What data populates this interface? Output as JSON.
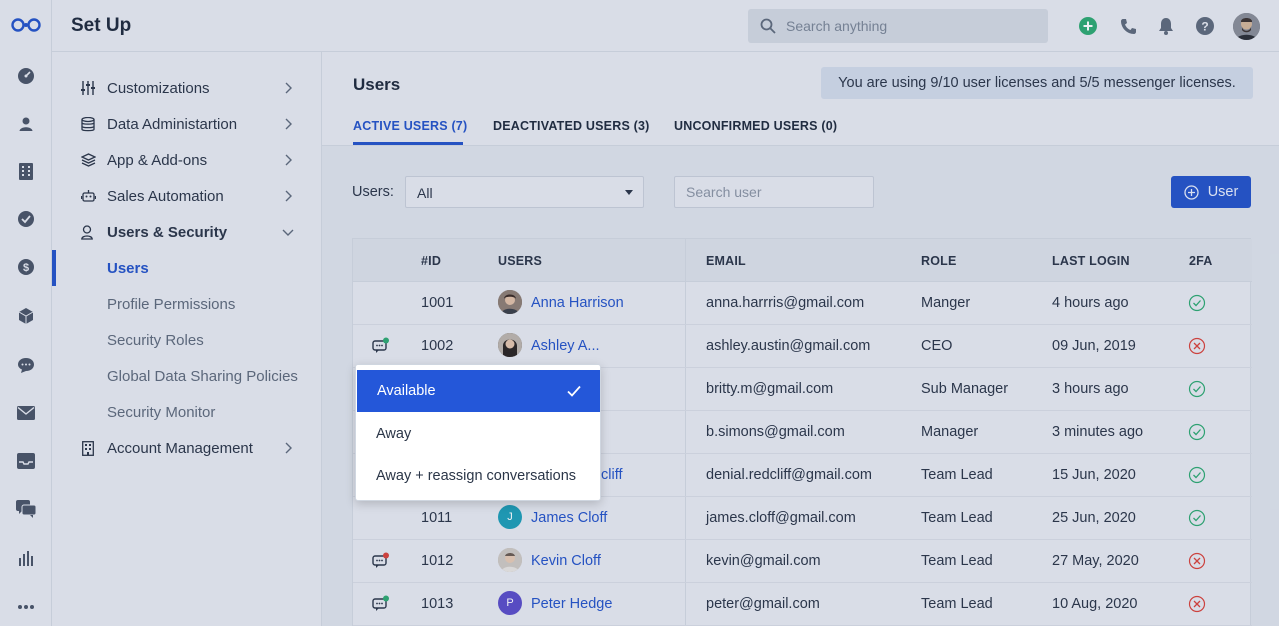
{
  "topbar": {
    "title": "Set Up",
    "search_placeholder": "Search anything",
    "icons": [
      "add-icon",
      "phone-icon",
      "bell-icon",
      "help-icon",
      "avatar"
    ]
  },
  "rail": {
    "icons": [
      "dashboard-icon",
      "contacts-icon",
      "accounts-icon",
      "tasks-icon",
      "deals-icon",
      "products-icon",
      "chat-icon",
      "mail-icon",
      "inbox-icon",
      "messenger-icon",
      "reports-icon",
      "more-icon"
    ]
  },
  "settings_nav": {
    "items": [
      {
        "label": "Customizations",
        "icon": "sliders-icon"
      },
      {
        "label": "Data Administartion",
        "icon": "database-icon"
      },
      {
        "label": "App & Add-ons",
        "icon": "layers-icon"
      },
      {
        "label": "Sales Automation",
        "icon": "robot-icon"
      },
      {
        "label": "Users & Security",
        "icon": "user-lock-icon"
      },
      {
        "label": "Account Management",
        "icon": "building-icon"
      }
    ],
    "sub_items": [
      "Users",
      "Profile Permissions",
      "Security Roles",
      "Global Data Sharing Policies",
      "Security Monitor"
    ]
  },
  "main": {
    "title": "Users",
    "license_notice": "You are using 9/10 user licenses and 5/5 messenger licenses.",
    "tabs": [
      "ACTIVE USERS (7)",
      "DEACTIVATED USERS (3)",
      "UNCONFIRMED USERS (0)"
    ],
    "filter_label": "Users:",
    "filter_value": "All",
    "search_placeholder": "Search user",
    "add_button": "User"
  },
  "table": {
    "columns": [
      "#ID",
      "USERS",
      "EMAIL",
      "ROLE",
      "LAST LOGIN",
      "2FA"
    ],
    "rows": [
      {
        "id": "1001",
        "name": "Anna Harrison",
        "email": "anna.harrris@gmail.com",
        "role": "Manger",
        "last_login": "4 hours ago",
        "twofa": true,
        "chat": ""
      },
      {
        "id": "1002",
        "name": "Ashley A...",
        "email": "ashley.austin@gmail.com",
        "role": "CEO",
        "last_login": "09 Jun, 2019",
        "twofa": false,
        "chat": "green"
      },
      {
        "id": "",
        "name": "",
        "email": "britty.m@gmail.com",
        "role": "Sub Manager",
        "last_login": "3 hours ago",
        "twofa": true,
        "chat": ""
      },
      {
        "id": "",
        "name": "ons",
        "email": "b.simons@gmail.com",
        "role": "Manager",
        "last_login": "3 minutes ago",
        "twofa": true,
        "chat": ""
      },
      {
        "id": "",
        "name": "cliff",
        "email": "denial.redcliff@gmail.com",
        "role": "Team Lead",
        "last_login": "15 Jun, 2020",
        "twofa": true,
        "chat": ""
      },
      {
        "id": "1011",
        "name": "James Cloff",
        "email": "james.cloff@gmail.com",
        "role": "Team Lead",
        "last_login": "25 Jun, 2020",
        "twofa": true,
        "chat": "",
        "avatar_letter": "J"
      },
      {
        "id": "1012",
        "name": "Kevin Cloff",
        "email": "kevin@gmail.com",
        "role": "Team Lead",
        "last_login": "27 May, 2020",
        "twofa": false,
        "chat": "red"
      },
      {
        "id": "1013",
        "name": "Peter Hedge",
        "email": "peter@gmail.com",
        "role": "Team Lead",
        "last_login": "10 Aug, 2020",
        "twofa": false,
        "chat": "green",
        "avatar_letter": "P"
      }
    ]
  },
  "status_menu": {
    "options": [
      "Available",
      "Away",
      "Away + reassign conversations"
    ],
    "selected": "Available"
  },
  "colors": {
    "accent": "#2454c9",
    "ok": "#2eaa72",
    "error": "#d9433b"
  }
}
